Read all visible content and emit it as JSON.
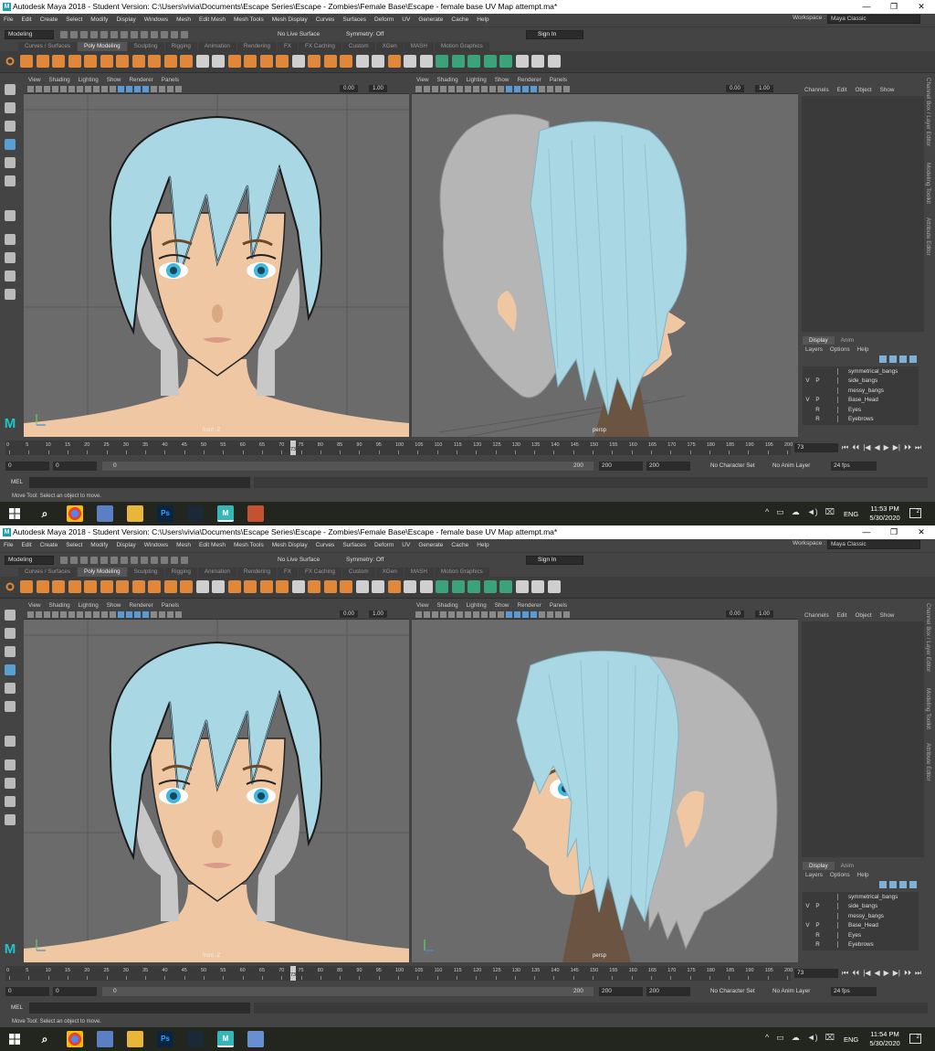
{
  "shots": [
    {
      "title": "Autodesk Maya 2018 - Student Version: C:\\Users\\vivia\\Documents\\Escape Series\\Escape - Zombies\\Female Base\\Escape - female base UV Map attempt.ma*",
      "time": "11:53 PM",
      "date": "5/30/2020",
      "right_view": "side",
      "extra_app_color": "#c4512f"
    },
    {
      "title": "Autodesk Maya 2018 - Student Version: C:\\Users\\vivia\\Documents\\Escape Series\\Escape - Zombies\\Female Base\\Escape - female base UV Map attempt.ma*",
      "time": "11:54 PM",
      "date": "5/30/2020",
      "right_view": "three-quarter",
      "extra_app_color": "#6a8fd1"
    }
  ],
  "window_controls": {
    "minimize": "—",
    "maximize": "❐",
    "close": "✕"
  },
  "menubar": [
    "File",
    "Edit",
    "Create",
    "Select",
    "Modify",
    "Display",
    "Windows",
    "Mesh",
    "Edit Mesh",
    "Mesh Tools",
    "Mesh Display",
    "Curves",
    "Surfaces",
    "Deform",
    "UV",
    "Generate",
    "Cache",
    "Help"
  ],
  "workspace": {
    "label": "Workspace :",
    "value": "Maya Classic"
  },
  "statusline": {
    "mode": "Modeling",
    "live_surface": "No Live Surface",
    "symmetry": "Symmetry: Off",
    "sign_in": "Sign In"
  },
  "shelf_tabs": [
    "Curves / Surfaces",
    "Poly Modeling",
    "Sculpting",
    "Rigging",
    "Animation",
    "Rendering",
    "FX",
    "FX Caching",
    "Custom",
    "XGen",
    "MASH",
    "Motion Graphics"
  ],
  "shelf_active": 1,
  "viewport_menu": [
    "View",
    "Shading",
    "Lighting",
    "Show",
    "Renderer",
    "Panels"
  ],
  "viewport_fields": {
    "near": "0.00",
    "far": "1.00"
  },
  "viewport_labels": {
    "left": "front -Z",
    "right": "persp"
  },
  "channel_box": {
    "menu": [
      "Channels",
      "Edit",
      "Object",
      "Show"
    ]
  },
  "layer_editor": {
    "tabs": [
      "Display",
      "Anim"
    ],
    "menu": [
      "Layers",
      "Options",
      "Help"
    ],
    "layers": [
      {
        "v": "",
        "p": "",
        "name": "symmetrical_bangs"
      },
      {
        "v": "V",
        "p": "P",
        "name": "side_bangs"
      },
      {
        "v": "",
        "p": "",
        "name": "messy_bangs"
      },
      {
        "v": "V",
        "p": "P",
        "name": "Base_Head"
      },
      {
        "v": "",
        "p": "R",
        "name": "Eyes"
      },
      {
        "v": "",
        "p": "R",
        "name": "Eyebrows"
      }
    ]
  },
  "side_tabs": [
    "Channel Box / Layer Editor",
    "Modeling Toolkit",
    "Attribute Editor"
  ],
  "timeline": {
    "ticks": [
      "0",
      "5",
      "10",
      "15",
      "20",
      "25",
      "30",
      "35",
      "40",
      "45",
      "50",
      "55",
      "60",
      "65",
      "70",
      "75",
      "80",
      "85",
      "90",
      "95",
      "100",
      "105",
      "110",
      "115",
      "120",
      "125",
      "130",
      "135",
      "140",
      "145",
      "150",
      "155",
      "160",
      "165",
      "170",
      "175",
      "180",
      "185",
      "190",
      "195",
      "200"
    ],
    "current": "73",
    "current_field": "73"
  },
  "playback_buttons": [
    "⏮",
    "⏴⏴",
    "|◀",
    "◀",
    "▶",
    "▶|",
    "⏵⏵",
    "⏭"
  ],
  "range": {
    "start": "0",
    "start2": "0",
    "track_start": "0",
    "track_end": "200",
    "end": "200",
    "end2": "200",
    "character_set": "No Character Set",
    "anim_layer": "No Anim Layer",
    "fps": "24 fps"
  },
  "command_line": {
    "label": "MEL"
  },
  "help_line": "Move Tool: Select an object to move.",
  "taskbar": {
    "lang": "ENG",
    "notifications": "2",
    "tray": [
      "^",
      "▭",
      "☁",
      "◄)",
      "⌧"
    ]
  },
  "colors": {
    "hair": "#a9d7e4",
    "skin": "#efc7a3",
    "hair_back": "#b5b5b5",
    "viewport_bg": "#6b6b6b",
    "iris": "#3fb7de"
  }
}
